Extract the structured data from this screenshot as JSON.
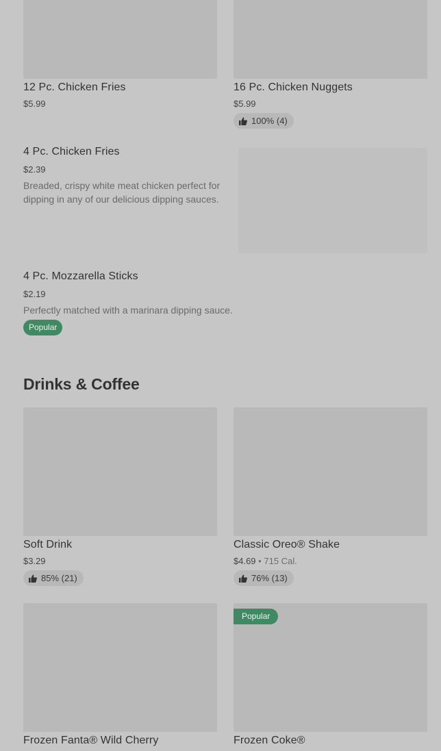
{
  "top_row": {
    "left": {
      "name": "12 Pc. Chicken Fries",
      "price": "$5.99"
    },
    "right": {
      "name": "16 Pc. Chicken Nuggets",
      "price": "$5.99",
      "rating": "100% (4)"
    }
  },
  "items": [
    {
      "name": "4 Pc. Chicken Fries",
      "price": "$2.39",
      "description": "Breaded, crispy white meat chicken perfect for dipping in any of our delicious dipping sauces."
    },
    {
      "name": "4 Pc. Mozzarella Sticks",
      "price": "$2.19",
      "description": "Perfectly matched with a marinara dipping sauce.",
      "badge": "Popular"
    }
  ],
  "drinks_section": {
    "title": "Drinks & Coffee",
    "row1": {
      "left": {
        "name": "Soft Drink",
        "price": "$3.29",
        "rating": "85% (21)"
      },
      "right": {
        "name": "Classic Oreo® Shake",
        "price": "$4.69",
        "separator": "•",
        "calories": "715 Cal.",
        "rating": "76% (13)"
      }
    },
    "row2": {
      "left": {
        "name": "Frozen Fanta® Wild Cherry"
      },
      "right": {
        "name": "Frozen Coke®",
        "badge": "Popular"
      }
    }
  },
  "icons": {
    "rating_icon": "thumbs-up-icon"
  },
  "colors": {
    "badge_green": "#3f8a62",
    "background": "#c6c6c6"
  }
}
